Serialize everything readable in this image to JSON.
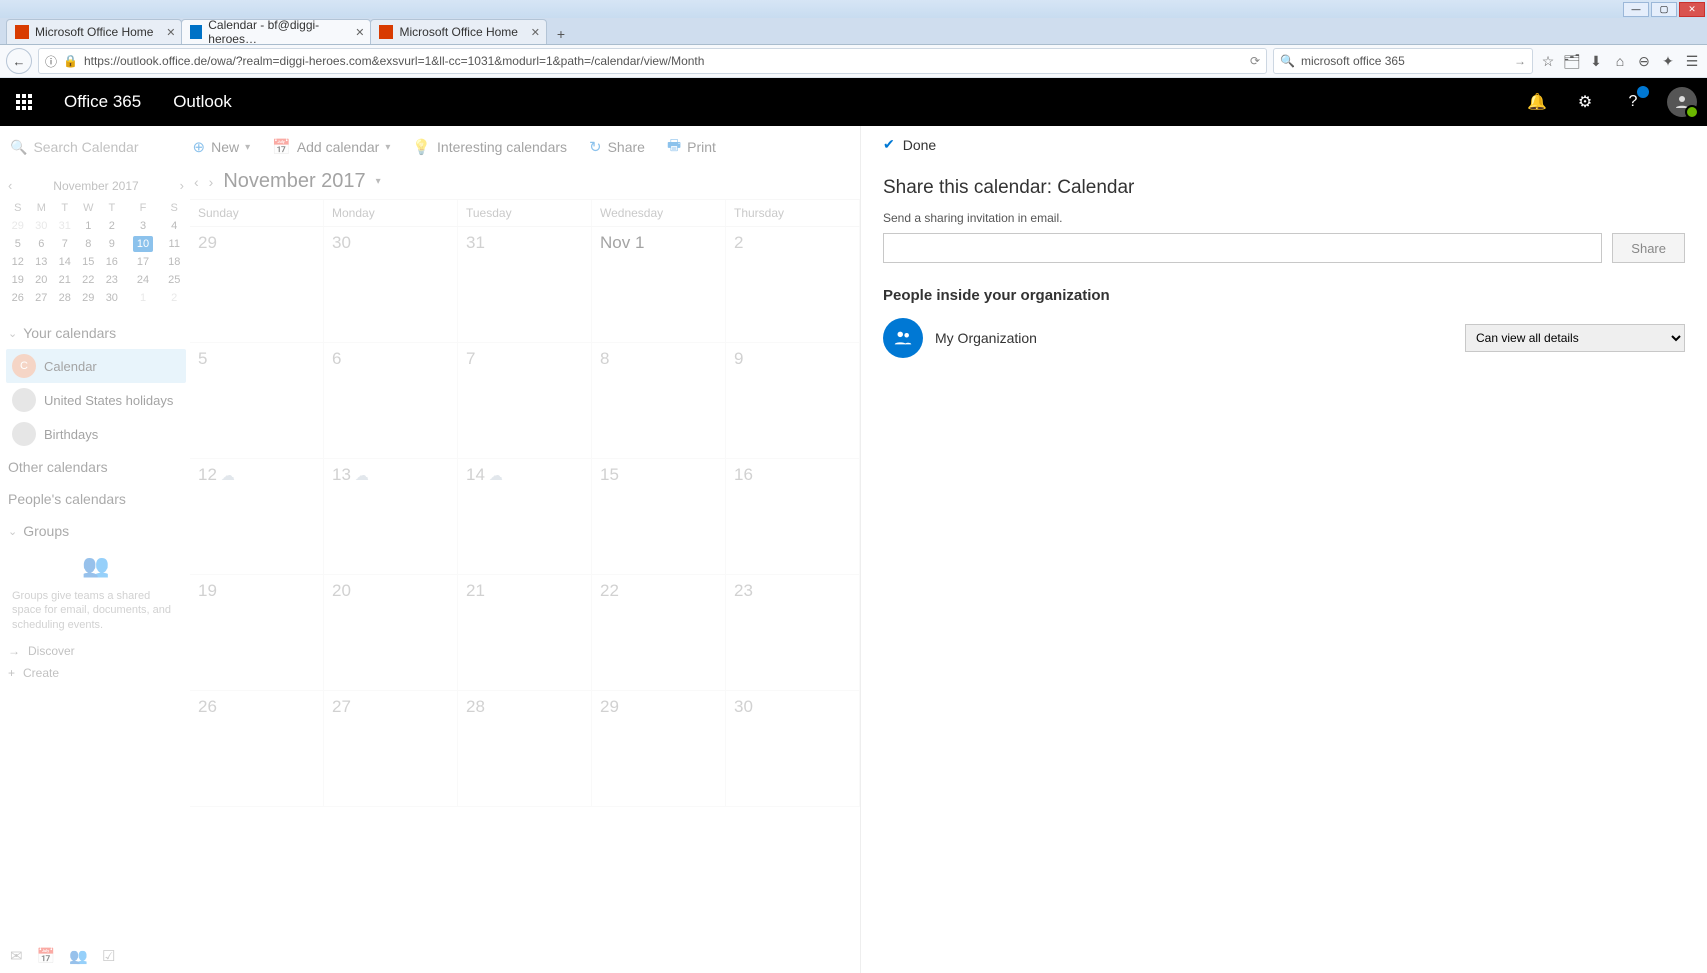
{
  "browser": {
    "tabs": [
      {
        "label": "Microsoft Office Home",
        "active": false
      },
      {
        "label": "Calendar - bf@diggi-heroes…",
        "active": true
      },
      {
        "label": "Microsoft Office Home",
        "active": false
      }
    ],
    "url": "https://outlook.office.de/owa/?realm=diggi-heroes.com&exsvurl=1&ll-cc=1031&modurl=1&path=/calendar/view/Month",
    "search": "microsoft office 365"
  },
  "header": {
    "suite": "Office 365",
    "app": "Outlook"
  },
  "commands": {
    "search_placeholder": "Search Calendar",
    "new": "New",
    "add_calendar": "Add calendar",
    "interesting": "Interesting calendars",
    "share": "Share",
    "print": "Print"
  },
  "mini": {
    "month": "November 2017",
    "dow": [
      "S",
      "M",
      "T",
      "W",
      "T",
      "F",
      "S"
    ],
    "rows": [
      [
        "29",
        "30",
        "31",
        "1",
        "2",
        "3",
        "4"
      ],
      [
        "5",
        "6",
        "7",
        "8",
        "9",
        "10",
        "11"
      ],
      [
        "12",
        "13",
        "14",
        "15",
        "16",
        "17",
        "18"
      ],
      [
        "19",
        "20",
        "21",
        "22",
        "23",
        "24",
        "25"
      ],
      [
        "26",
        "27",
        "28",
        "29",
        "30",
        "1",
        "2"
      ]
    ],
    "today": "10"
  },
  "sidebar": {
    "your_calendars": "Your calendars",
    "items": [
      {
        "label": "Calendar",
        "badge": "C",
        "color": "dot-orange",
        "selected": true
      },
      {
        "label": "United States holidays",
        "badge": "",
        "color": "dot-grey",
        "selected": false
      },
      {
        "label": "Birthdays",
        "badge": "",
        "color": "dot-grey",
        "selected": false
      }
    ],
    "other": "Other calendars",
    "peoples": "People's calendars",
    "groups": "Groups",
    "groups_msg": "Groups give teams a shared space for email, documents, and scheduling events.",
    "discover": "Discover",
    "create": "Create"
  },
  "calendar": {
    "title": "November 2017",
    "days": [
      "Sunday",
      "Monday",
      "Tuesday",
      "Wednesday",
      "Thursday"
    ],
    "cells": [
      [
        "29",
        "30",
        "31",
        "Nov 1",
        "2"
      ],
      [
        "5",
        "6",
        "7",
        "8",
        "9"
      ],
      [
        "12",
        "13",
        "14",
        "15",
        "16"
      ],
      [
        "19",
        "20",
        "21",
        "22",
        "23"
      ],
      [
        "26",
        "27",
        "28",
        "29",
        "30"
      ]
    ],
    "weather_row": 2
  },
  "panel": {
    "done": "Done",
    "title": "Share this calendar: Calendar",
    "subtitle": "Send a sharing invitation in email.",
    "share_btn": "Share",
    "section": "People inside your organization",
    "org": "My Organization",
    "permission": "Can view all details"
  }
}
